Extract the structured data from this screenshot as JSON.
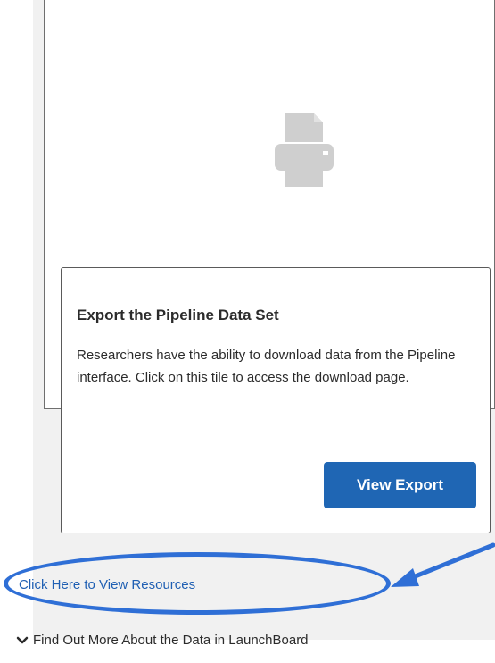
{
  "tile": {
    "icon": "printer-icon"
  },
  "popover": {
    "title": "Export the Pipeline Data Set",
    "description": "Researchers have the ability to download data from the Pipeline interface. Click on this tile to access the download page.",
    "button_label": "View Export",
    "button_color": "#1f66b4"
  },
  "links": {
    "resources": "Click Here to View Resources",
    "find_out_more": "Find Out More About the Data in LaunchBoard",
    "find_out_more_icon": "chevron-down-icon"
  },
  "annotation": {
    "highlight_color": "#2f6fd6",
    "arrow_icon": "arrow-icon"
  }
}
